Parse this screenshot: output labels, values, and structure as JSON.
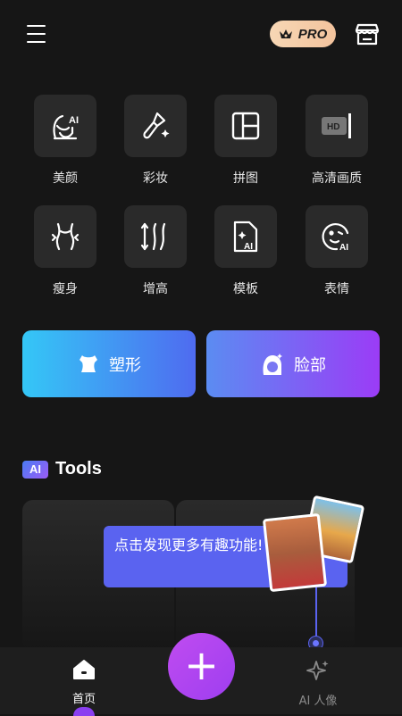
{
  "header": {
    "pro_label": "PRO"
  },
  "features": [
    {
      "label": "美颜",
      "icon": "ai-face-icon"
    },
    {
      "label": "彩妆",
      "icon": "makeup-brush-icon"
    },
    {
      "label": "拼图",
      "icon": "collage-icon"
    },
    {
      "label": "高清画质",
      "icon": "hd-icon"
    },
    {
      "label": "瘦身",
      "icon": "body-slim-icon"
    },
    {
      "label": "增高",
      "icon": "height-increase-icon"
    },
    {
      "label": "模板",
      "icon": "ai-template-icon"
    },
    {
      "label": "表情",
      "icon": "ai-expression-icon"
    }
  ],
  "big_buttons": [
    {
      "label": "塑形",
      "icon": "body-shape-icon"
    },
    {
      "label": "脸部",
      "icon": "face-icon"
    }
  ],
  "ai_tools": {
    "badge": "AI",
    "title": "Tools"
  },
  "tooltip": {
    "text": "点击发现更多有趣功能!"
  },
  "tabbar": {
    "home_label": "首页",
    "ai_label": "AI 人像",
    "fab_symbol": "+"
  },
  "colors": {
    "accent": "#5a63f0",
    "fab": "#b046f0",
    "pro_bg": "#f5cfaa"
  }
}
